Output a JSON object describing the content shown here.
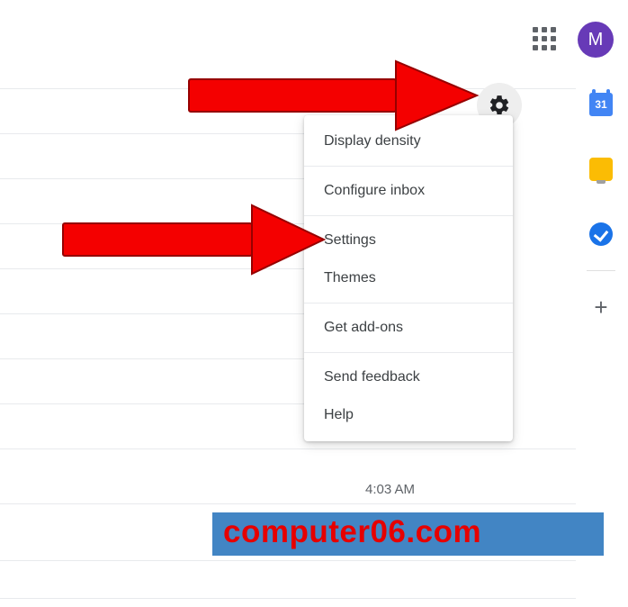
{
  "header": {
    "avatar_initial": "M"
  },
  "side": {
    "calendar_day": "31"
  },
  "menu": {
    "items": [
      "Display density",
      "Configure inbox",
      "Settings",
      "Themes",
      "Get add-ons",
      "Send feedback",
      "Help"
    ]
  },
  "timestamps": {
    "t1": "4:03 AM"
  },
  "watermark": "computer06.com"
}
